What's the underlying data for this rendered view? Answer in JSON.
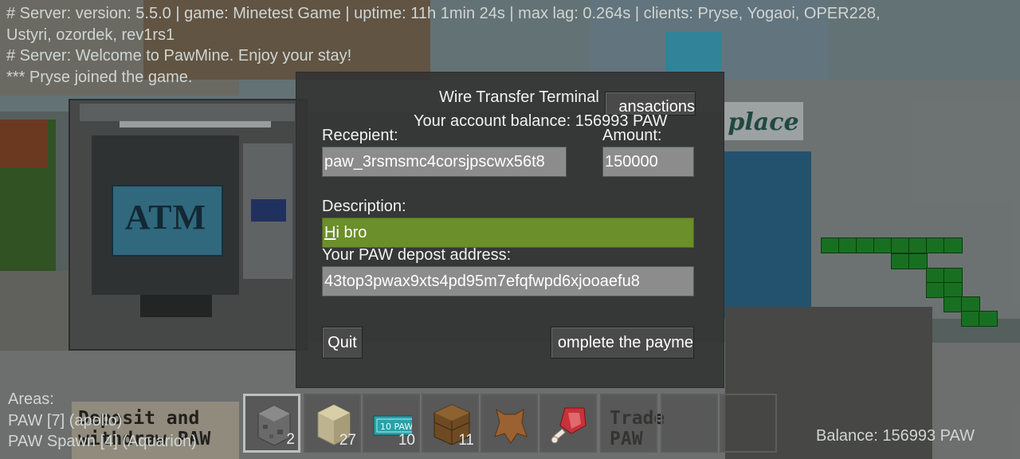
{
  "chat": [
    "# Server: version: 5.5.0 | game: Minetest Game | uptime: 11h 1min 24s | max lag: 0.264s | clients: Pryse, Yogaoi, OPER228,",
    "Ustyri, ozordek, rev1rs1",
    "# Server: Welcome to PawMine. Enjoy your stay!",
    "*** Pryse joined the game."
  ],
  "world": {
    "atm_label": "ATM",
    "store_sign": "place",
    "sign_left": "Deposit and\nwithdraw PAW",
    "sign_right": "Trade\nPAW"
  },
  "dialog": {
    "title": "Wire Transfer Terminal",
    "transactions_button": "ansactions",
    "balance_text": "Your account balance: 156993 PAW",
    "recipient_label": "Recepient:",
    "recipient_value": "paw_3rsmsmc4corsjpscwx56t8",
    "amount_label": "Amount:",
    "amount_value": "150000",
    "description_label": "Description:",
    "description_value_first": "H",
    "description_value_rest": "i bro",
    "deposit_label": "Your PAW depost address:",
    "deposit_value": "43top3pwax9xts4pd95m7efqfwpd6xjooaefu8",
    "quit_button": "Quit",
    "complete_button": "omplete the payme"
  },
  "hud": {
    "areas": [
      "Areas:",
      "PAW [7] (apollo)",
      "PAW Spawn [4] (Aquarion)"
    ],
    "balance": "Balance: 156993 PAW"
  },
  "hotbar": {
    "selected_index": 0,
    "slots": [
      {
        "icon": "cobblestone-icon",
        "count": "2"
      },
      {
        "icon": "sandstone-icon",
        "count": "27"
      },
      {
        "icon": "paw-banknote-icon",
        "label": "10 PAW",
        "count": "10"
      },
      {
        "icon": "wooden-chest-icon",
        "count": "11"
      },
      {
        "icon": "leather-icon",
        "count": ""
      },
      {
        "icon": "raw-meat-icon",
        "count": ""
      },
      {
        "icon": "empty-slot",
        "count": ""
      },
      {
        "icon": "empty-slot",
        "count": ""
      },
      {
        "icon": "empty-slot",
        "count": ""
      }
    ]
  },
  "colors": {
    "field_bg": "#8c8c8c",
    "field_focused_bg": "#6b8f2a",
    "dialog_bg": "#343434",
    "text": "#ffffff"
  }
}
